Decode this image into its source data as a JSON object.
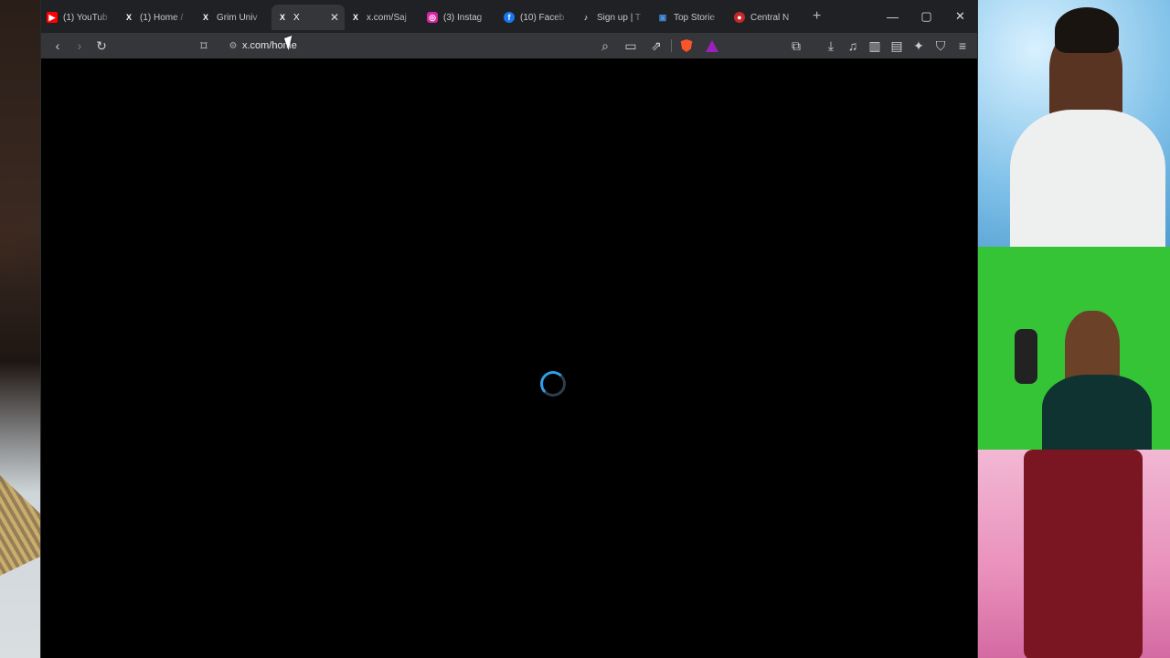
{
  "browser": {
    "tabs": [
      {
        "label": "(1) YouTub",
        "icon": "youtube-icon",
        "color": "#ff0000",
        "active": false
      },
      {
        "label": "(1) Home /",
        "icon": "x-logo-icon",
        "color": "#000000",
        "active": false
      },
      {
        "label": "Grim Univ",
        "icon": "x-logo-icon",
        "color": "#000000",
        "active": false
      },
      {
        "label": "X",
        "icon": "x-logo-icon",
        "color": "#000000",
        "active": true
      },
      {
        "label": "x.com/Saj",
        "icon": "x-logo-icon",
        "color": "#000000",
        "active": false
      },
      {
        "label": "(3) Instag",
        "icon": "instagram-icon",
        "color": "#d6249f",
        "active": false
      },
      {
        "label": "(10) Faceb",
        "icon": "facebook-icon",
        "color": "#1877f2",
        "active": false
      },
      {
        "label": "Sign up | T",
        "icon": "tiktok-icon",
        "color": "#000000",
        "active": false
      },
      {
        "label": "Top Storie",
        "icon": "news-icon",
        "color": "#1a73e8",
        "active": false
      },
      {
        "label": "Central N",
        "icon": "globe-icon",
        "color": "#c62828",
        "active": false
      }
    ],
    "new_tab": "+",
    "url": "x.com/home"
  },
  "content": {
    "state": "loading"
  },
  "colors": {
    "tabbar": "#202124",
    "toolbar": "#35363a",
    "spinner": "#2f9ee8",
    "page_background": "#000000"
  }
}
